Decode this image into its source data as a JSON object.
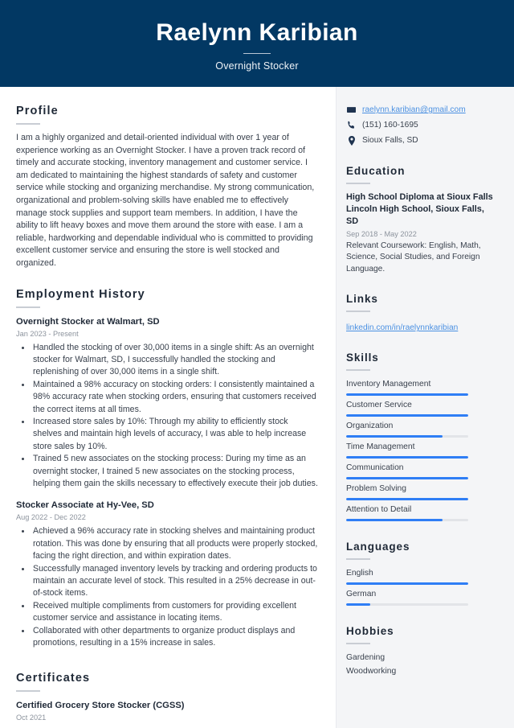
{
  "header": {
    "name": "Raelynn Karibian",
    "job_title": "Overnight Stocker",
    "bg_color": "#023863"
  },
  "theme": {
    "accent": "#2f7ef5",
    "link": "#4a90e2",
    "sidebar_bg": "#f4f5f7"
  },
  "main": {
    "profile": {
      "heading": "Profile",
      "text": "I am a highly organized and detail-oriented individual with over 1 year of experience working as an Overnight Stocker. I have a proven track record of timely and accurate stocking, inventory management and customer service. I am dedicated to maintaining the highest standards of safety and customer service while stocking and organizing merchandise. My strong communication, organizational and problem-solving skills have enabled me to effectively manage stock supplies and support team members. In addition, I have the ability to lift heavy boxes and move them around the store with ease. I am a reliable, hardworking and dependable individual who is committed to providing excellent customer service and ensuring the store is well stocked and organized."
    },
    "employment": {
      "heading": "Employment History",
      "jobs": [
        {
          "title": "Overnight Stocker at Walmart, SD",
          "date": "Jan 2023 - Present",
          "bullets": [
            "Handled the stocking of over 30,000 items in a single shift: As an overnight stocker for Walmart, SD, I successfully handled the stocking and replenishing of over 30,000 items in a single shift.",
            "Maintained a 98% accuracy on stocking orders: I consistently maintained a 98% accuracy rate when stocking orders, ensuring that customers received the correct items at all times.",
            "Increased store sales by 10%: Through my ability to efficiently stock shelves and maintain high levels of accuracy, I was able to help increase store sales by 10%.",
            "Trained 5 new associates on the stocking process: During my time as an overnight stocker, I trained 5 new associates on the stocking process, helping them gain the skills necessary to effectively execute their job duties."
          ]
        },
        {
          "title": "Stocker Associate at Hy-Vee, SD",
          "date": "Aug 2022 - Dec 2022",
          "bullets": [
            "Achieved a 96% accuracy rate in stocking shelves and maintaining product rotation. This was done by ensuring that all products were properly stocked, facing the right direction, and within expiration dates.",
            "Successfully managed inventory levels by tracking and ordering products to maintain an accurate level of stock. This resulted in a 25% decrease in out-of-stock items.",
            "Received multiple compliments from customers for providing excellent customer service and assistance in locating items.",
            "Collaborated with other departments to organize product displays and promotions, resulting in a 15% increase in sales."
          ]
        }
      ]
    },
    "certificates": {
      "heading": "Certificates",
      "items": [
        {
          "title": "Certified Grocery Store Stocker (CGSS)",
          "date": "Oct 2021"
        }
      ]
    }
  },
  "sidebar": {
    "contact": [
      {
        "icon": "envelope-icon",
        "text": "raelynn.karibian@gmail.com",
        "is_link": true
      },
      {
        "icon": "phone-icon",
        "text": "(151) 160-1695",
        "is_link": false
      },
      {
        "icon": "location-pin-icon",
        "text": "Sioux Falls, SD",
        "is_link": false
      }
    ],
    "education": {
      "heading": "Education",
      "items": [
        {
          "title": "High School Diploma at Sioux Falls Lincoln High School, Sioux Falls, SD",
          "date": "Sep 2018 - May 2022",
          "description": "Relevant Coursework: English, Math, Science, Social Studies, and Foreign Language."
        }
      ]
    },
    "links": {
      "heading": "Links",
      "items": [
        {
          "label": "linkedin.com/in/raelynnkaribian"
        }
      ]
    },
    "skills": {
      "heading": "Skills",
      "items": [
        {
          "label": "Inventory Management",
          "level": 100
        },
        {
          "label": "Customer Service",
          "level": 100
        },
        {
          "label": "Organization",
          "level": 79
        },
        {
          "label": "Time Management",
          "level": 100
        },
        {
          "label": "Communication",
          "level": 100
        },
        {
          "label": "Problem Solving",
          "level": 100
        },
        {
          "label": "Attention to Detail",
          "level": 79
        }
      ]
    },
    "languages": {
      "heading": "Languages",
      "items": [
        {
          "label": "English",
          "level": 100
        },
        {
          "label": "German",
          "level": 20
        }
      ]
    },
    "hobbies": {
      "heading": "Hobbies",
      "items": [
        {
          "label": "Gardening"
        },
        {
          "label": "Woodworking"
        }
      ]
    }
  }
}
